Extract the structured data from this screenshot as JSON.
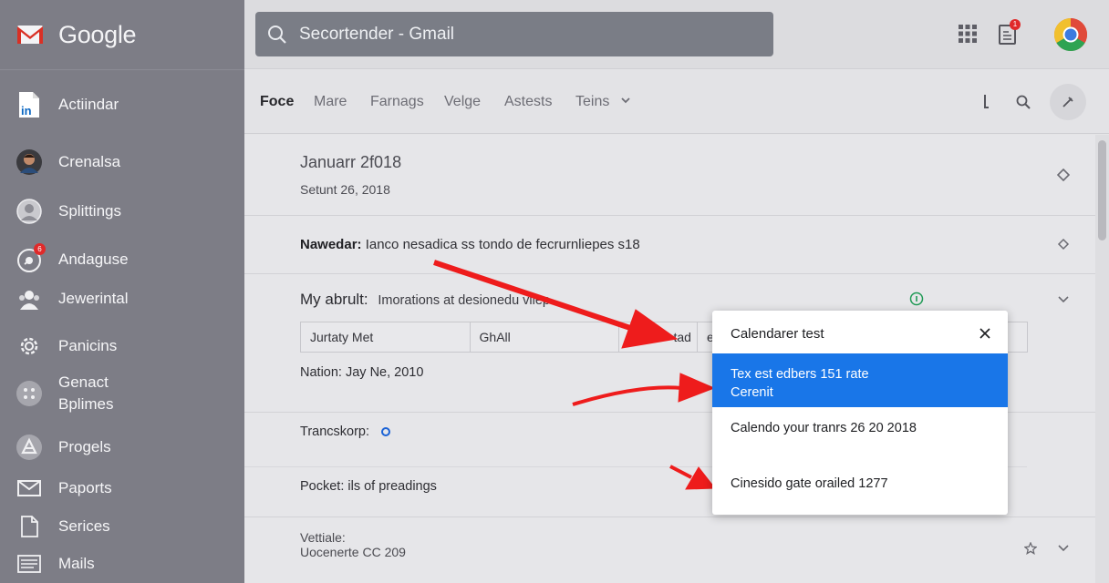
{
  "brand": {
    "wordmark": "Google"
  },
  "sidebar": {
    "items": [
      {
        "label": "Actiindar",
        "icon": "linkedin-icon"
      },
      {
        "label": "Crenalsa",
        "icon": "avatar-icon"
      },
      {
        "label": "Splittings",
        "icon": "person-icon"
      },
      {
        "label": "Andaguse",
        "icon": "clock-icon",
        "badge": "6"
      },
      {
        "label": "Jewerintal",
        "icon": "group-icon"
      },
      {
        "label": "Panicins",
        "icon": "gear-icon"
      },
      {
        "label": "Genact",
        "label2": "Bplimes",
        "icon": "apps-icon"
      },
      {
        "label": "Progels",
        "icon": "drive-icon"
      },
      {
        "label": "Paports",
        "icon": "mail-icon"
      },
      {
        "label": "Serices",
        "icon": "document-icon"
      },
      {
        "label": "Mails",
        "icon": "inbox-icon"
      }
    ]
  },
  "search": {
    "value": "Secortender - Gmail"
  },
  "topbar": {
    "notification_badge": "1"
  },
  "tabs": [
    {
      "label": "Foce",
      "active": true
    },
    {
      "label": "Mare"
    },
    {
      "label": "Farnags"
    },
    {
      "label": "Velge"
    },
    {
      "label": "Astests"
    },
    {
      "label": "Teins"
    }
  ],
  "rows": {
    "date": {
      "title": "Januarr 2f018",
      "subtitle": "Setunt 26, 2018"
    },
    "news": {
      "bold": "Nawedar:",
      "text": "Ianco nesadica ss tondo de fecrurnliepes s18"
    },
    "my": {
      "bold": "My abrult:",
      "text": "Imorations at desionedu vilep",
      "cells": [
        "Jurtaty Met",
        "GhAll",
        "tad",
        "e"
      ],
      "nation": "Nation: Jay Ne, 2010"
    },
    "transactions": {
      "text": "Trancskorp:"
    },
    "pocket": {
      "text": "Pocket: ils of preadings"
    },
    "footer": {
      "line1": "Vettiale:",
      "line2": "Uocenerte CC 209"
    }
  },
  "popup": {
    "title": "Calendarer test",
    "options": [
      {
        "line1": "Tex est edbers 151 rate",
        "line2": "Cerenit",
        "selected": true
      },
      {
        "line1": "Calendo your tranrs 26 20 2018"
      },
      {
        "line1": "Cinesido gate orailed 1277"
      }
    ]
  },
  "colors": {
    "sidebar_bg": "#7d7d86",
    "selection_blue": "#1976e8",
    "arrow_red": "#ee1c1c",
    "gmail_red": "#d93025"
  }
}
